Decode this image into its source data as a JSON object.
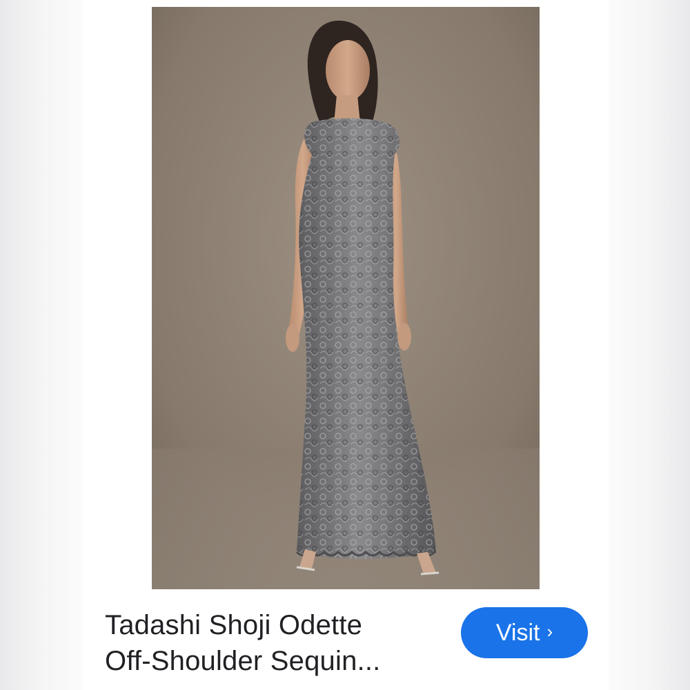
{
  "result": {
    "title_line1": "Tadashi Shoji Odette",
    "title_line2": "Off-Shoulder Sequin...",
    "visit_label": "Visit",
    "visit_icon": "chevron-right-icon",
    "visit_chevron": "›"
  },
  "colors": {
    "visit_button": "#1a73e8",
    "title_text": "#202124",
    "backdrop": "#8c7f72",
    "dress": "#6e6e70"
  }
}
